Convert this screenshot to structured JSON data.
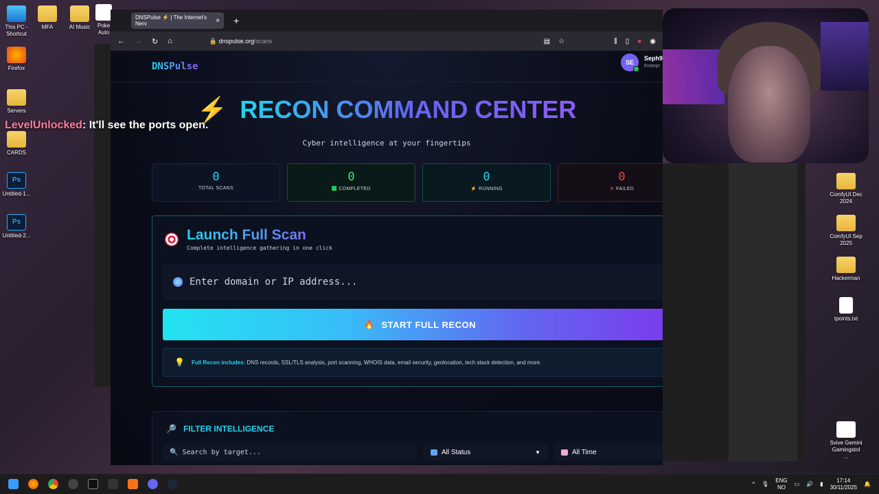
{
  "desktop": {
    "left_icons": [
      {
        "label": "This PC - Shortcut",
        "icon": "pc-icon"
      },
      {
        "label": "Firefox",
        "icon": "firefox-icon"
      },
      {
        "label": "Servers",
        "icon": "folder-icon"
      },
      {
        "label": "CARDS",
        "icon": "folder-icon"
      },
      {
        "label": "Untitled-1...",
        "icon": "psd-icon"
      },
      {
        "label": "Untitled-2...",
        "icon": "psd-icon"
      }
    ],
    "top_icons": [
      {
        "label": "MFA",
        "icon": "folder-icon"
      },
      {
        "label": "AI Music",
        "icon": "folder-icon"
      },
      {
        "label": "Poke Auto",
        "icon": "app-icon"
      }
    ],
    "right_icons": [
      {
        "label": "ComfyUI Dec 2024",
        "icon": "folder-icon"
      },
      {
        "label": "ComfyUI Sep 2025",
        "icon": "folder-icon"
      },
      {
        "label": "Hackerman",
        "icon": "folder-icon"
      },
      {
        "label": "tpoints.txt",
        "icon": "text-file-icon"
      },
      {
        "label": "Svive Gemini Gamingstol ...",
        "icon": "app-icon"
      }
    ]
  },
  "chat": {
    "user": "LevelUnlocked",
    "message": ": It'll see the ports open."
  },
  "browser": {
    "tab_title": "DNSPulse ⚡ | The Internet's Nerv",
    "url_host": "dnspulse.org",
    "url_path": "/scans"
  },
  "page": {
    "logo": "DNSPulse",
    "user": {
      "initials": "SE",
      "name": "Seph9",
      "plan": "Enterpr"
    },
    "hero_title": "RECON COMMAND CENTER",
    "hero_subtitle": "Cyber intelligence at your fingertips",
    "stats": [
      {
        "value": "0",
        "label": "TOTAL SCANS"
      },
      {
        "value": "0",
        "label": "COMPLETED"
      },
      {
        "value": "0",
        "label": "RUNNING"
      },
      {
        "value": "0",
        "label": "FAILED"
      }
    ],
    "scan": {
      "title": "Launch Full Scan",
      "subtitle": "Complete intelligence gathering in one click",
      "input_placeholder": "Enter domain or IP address...",
      "button_label": "START FULL RECON",
      "info_label": "Full Recon includes:",
      "info_text": " DNS records, SSL/TLS analysis, port scanning, WHOIS data, email security, geolocation, tech stack detection, and more."
    },
    "filter": {
      "title": "FILTER INTELLIGENCE",
      "search_placeholder": "Search by target...",
      "status_value": "All Status",
      "time_value": "All Time"
    }
  },
  "taskbar": {
    "lang_top": "ENG",
    "lang_bottom": "NO",
    "time": "17:14",
    "date": "30/11/2025"
  }
}
